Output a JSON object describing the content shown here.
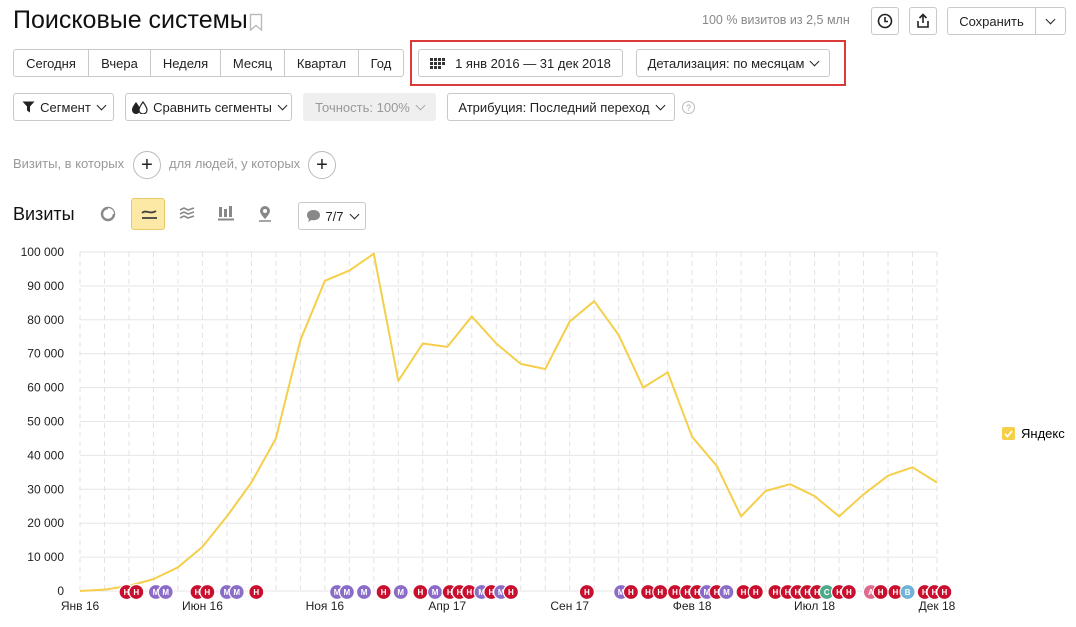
{
  "header": {
    "title": "Поисковые системы",
    "visits_share": "100 % визитов из 2,5 млн",
    "save_label": "Сохранить"
  },
  "periods": [
    "Сегодня",
    "Вчера",
    "Неделя",
    "Месяц",
    "Квартал",
    "Год"
  ],
  "date_range": "1 янв 2016 — 31 дек 2018",
  "detail": "Детализация: по месяцам",
  "filters": {
    "segment": "Сегмент",
    "compare": "Сравнить сегменты",
    "accuracy": "Точность: 100%",
    "attribution": "Атрибуция: Последний переход"
  },
  "conditions": {
    "visits": "Визиты, в которых",
    "people": "для людей, у которых"
  },
  "chart_header": {
    "title": "Визиты",
    "notes_count": "7/7"
  },
  "colors": {
    "line": "#f5cf4a",
    "highlight": "#d93b3b",
    "note_red": "#c8102e",
    "note_purple": "#8b6cc8",
    "note_green": "#4daa8a",
    "note_pink": "#e06a8c",
    "note_blue": "#6fb3d6"
  },
  "chart_data": {
    "type": "line",
    "ylim": [
      0,
      100000
    ],
    "yticks": [
      "0",
      "10 000",
      "20 000",
      "30 000",
      "40 000",
      "50 000",
      "60 000",
      "70 000",
      "80 000",
      "90 000",
      "100 000"
    ],
    "xticks": [
      "Янв 16",
      "Июн 16",
      "Ноя 16",
      "Апр 17",
      "Сен 17",
      "Фев 18",
      "Июл 18",
      "Дек 18"
    ],
    "legend_position": "right",
    "series": [
      {
        "name": "Яндекс",
        "values": [
          0,
          400,
          1500,
          3500,
          7000,
          13000,
          22000,
          32000,
          45000,
          74000,
          91500,
          94500,
          99500,
          62000,
          73000,
          72000,
          81000,
          73000,
          67000,
          65500,
          79500,
          85500,
          75500,
          60000,
          64500,
          45500,
          37000,
          22000,
          29500,
          31500,
          28000,
          22000,
          28500,
          34000,
          36500,
          32000
        ]
      }
    ],
    "annotations": {
      "labels": [
        "Н",
        "Н",
        "М",
        "М",
        "Н",
        "Н",
        "М",
        "М",
        "Н",
        "М",
        "М",
        "М",
        "Н",
        "М",
        "Н",
        "М",
        "Н",
        "Н",
        "Н",
        "М",
        "Н",
        "М",
        "Н",
        "Н",
        "М",
        "Н",
        "Н",
        "Н",
        "Н",
        "Н",
        "Н",
        "М",
        "Н",
        "М",
        "Н",
        "Н",
        "Н",
        "Н",
        "Н",
        "Н",
        "Н",
        "С",
        "Н",
        "Н",
        "А",
        "Н",
        "Н",
        "В",
        "Н",
        "Н",
        "Н"
      ],
      "kinds": [
        "r",
        "r",
        "p",
        "p",
        "r",
        "r",
        "p",
        "p",
        "r",
        "p",
        "p",
        "p",
        "r",
        "p",
        "r",
        "p",
        "r",
        "r",
        "r",
        "p",
        "r",
        "p",
        "r",
        "r",
        "p",
        "r",
        "r",
        "r",
        "r",
        "r",
        "r",
        "p",
        "r",
        "p",
        "r",
        "r",
        "r",
        "r",
        "r",
        "r",
        "r",
        "g",
        "r",
        "r",
        "k",
        "r",
        "r",
        "b",
        "r",
        "r",
        "r"
      ],
      "months": [
        1.9,
        2.3,
        3.1,
        3.5,
        4.8,
        5.2,
        6.0,
        6.4,
        7.2,
        10.5,
        10.9,
        11.6,
        12.4,
        13.1,
        13.9,
        14.5,
        15.1,
        15.5,
        15.9,
        16.4,
        16.8,
        17.2,
        17.6,
        20.7,
        22.1,
        22.5,
        23.2,
        23.7,
        24.3,
        24.8,
        25.2,
        25.6,
        26.0,
        26.4,
        27.1,
        27.6,
        28.4,
        28.9,
        29.3,
        29.7,
        30.1,
        30.5,
        31.0,
        31.4,
        32.3,
        32.7,
        33.3,
        33.8,
        34.5,
        34.9,
        35.3
      ]
    }
  }
}
